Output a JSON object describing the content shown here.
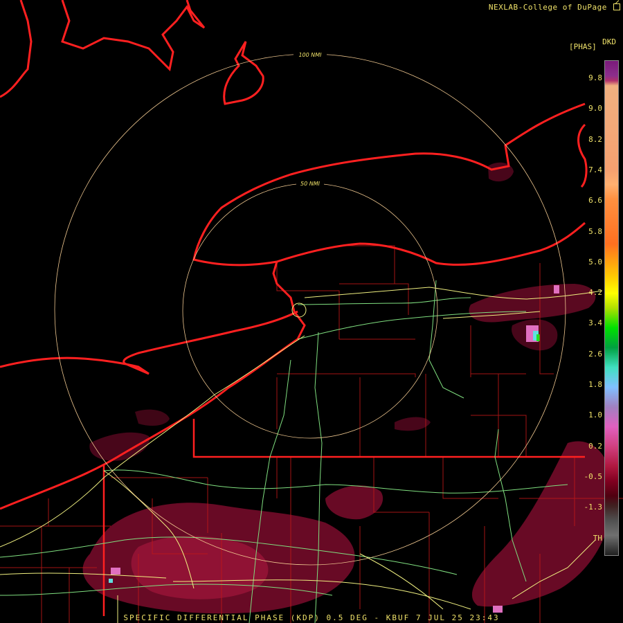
{
  "credit": "NEXLAB-College of DuPage",
  "credit_icon": "external-link-icon",
  "legend": {
    "unit": "[PHAS]",
    "product": "DKD",
    "labels": [
      "9.8",
      "9.0",
      "8.2",
      "7.4",
      "6.6",
      "5.8",
      "5.0",
      "4.2",
      "3.4",
      "2.6",
      "1.8",
      "1.0",
      "0.2",
      "-0.5",
      "-1.3",
      "TH"
    ]
  },
  "range_rings": [
    "100 NMI",
    "50 NMI"
  ],
  "footer": "SPECIFIC DIFFERENTIAL PHASE (KDP) 0.5 DEG - KBUF 7 JUL 25 23:43",
  "colors": {
    "shoreline": "#ff2020",
    "state_border": "#ff2020",
    "county_lines": "#c01818",
    "highways": "#f0f080",
    "interstates": "#80e080",
    "range_rings": "#f0c890",
    "echo_main": "#8a1030",
    "echo_light": "#5a0820",
    "echo_hot": "#e070c0",
    "echo_cyan": "#60e0e0",
    "echo_green": "#20e020"
  }
}
